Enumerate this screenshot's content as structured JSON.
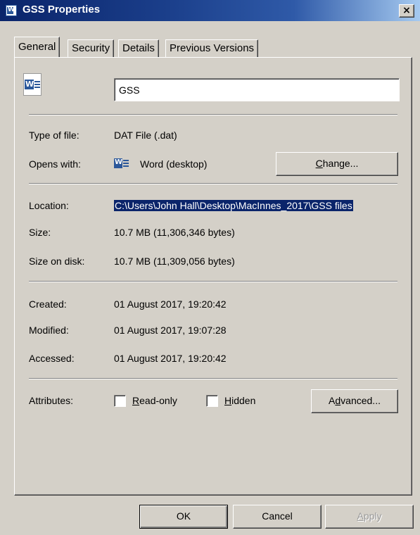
{
  "window": {
    "title": "GSS Properties",
    "close_glyph": "×",
    "icon": "word-document-icon"
  },
  "tabs": [
    {
      "label": "General",
      "active": true
    },
    {
      "label": "Security",
      "active": false
    },
    {
      "label": "Details",
      "active": false
    },
    {
      "label": "Previous Versions",
      "active": false
    }
  ],
  "general": {
    "file_name": "GSS",
    "type_of_file_label": "Type of file:",
    "type_of_file_value": "DAT File (.dat)",
    "opens_with_label": "Opens with:",
    "opens_with_value": "Word (desktop)",
    "change_button": {
      "before": "",
      "accel": "C",
      "after": "hange..."
    },
    "location_label": "Location:",
    "location_value": "C:\\Users\\John Hall\\Desktop\\MacInnes_2017\\GSS files",
    "size_label": "Size:",
    "size_value": "10.7 MB (11,306,346 bytes)",
    "size_on_disk_label": "Size on disk:",
    "size_on_disk_value": "10.7 MB (11,309,056 bytes)",
    "created_label": "Created:",
    "created_value": "01 August 2017, 19:20:42",
    "modified_label": "Modified:",
    "modified_value": "01 August 2017, 19:07:28",
    "accessed_label": "Accessed:",
    "accessed_value": "01 August 2017, 19:20:42",
    "attributes_label": "Attributes:",
    "read_only": {
      "before": "",
      "accel": "R",
      "after": "ead-only",
      "checked": false
    },
    "hidden": {
      "before": "",
      "accel": "H",
      "after": "idden",
      "checked": false
    },
    "advanced_button": {
      "before": "A",
      "accel": "d",
      "after": "vanced..."
    }
  },
  "footer": {
    "ok_label": "OK",
    "cancel_label": "Cancel",
    "apply": {
      "before": "",
      "accel": "A",
      "after": "pply",
      "disabled": true
    }
  },
  "colors": {
    "face": "#d4d0c8",
    "selection": "#0a246a",
    "word_blue": "#2b579a"
  }
}
